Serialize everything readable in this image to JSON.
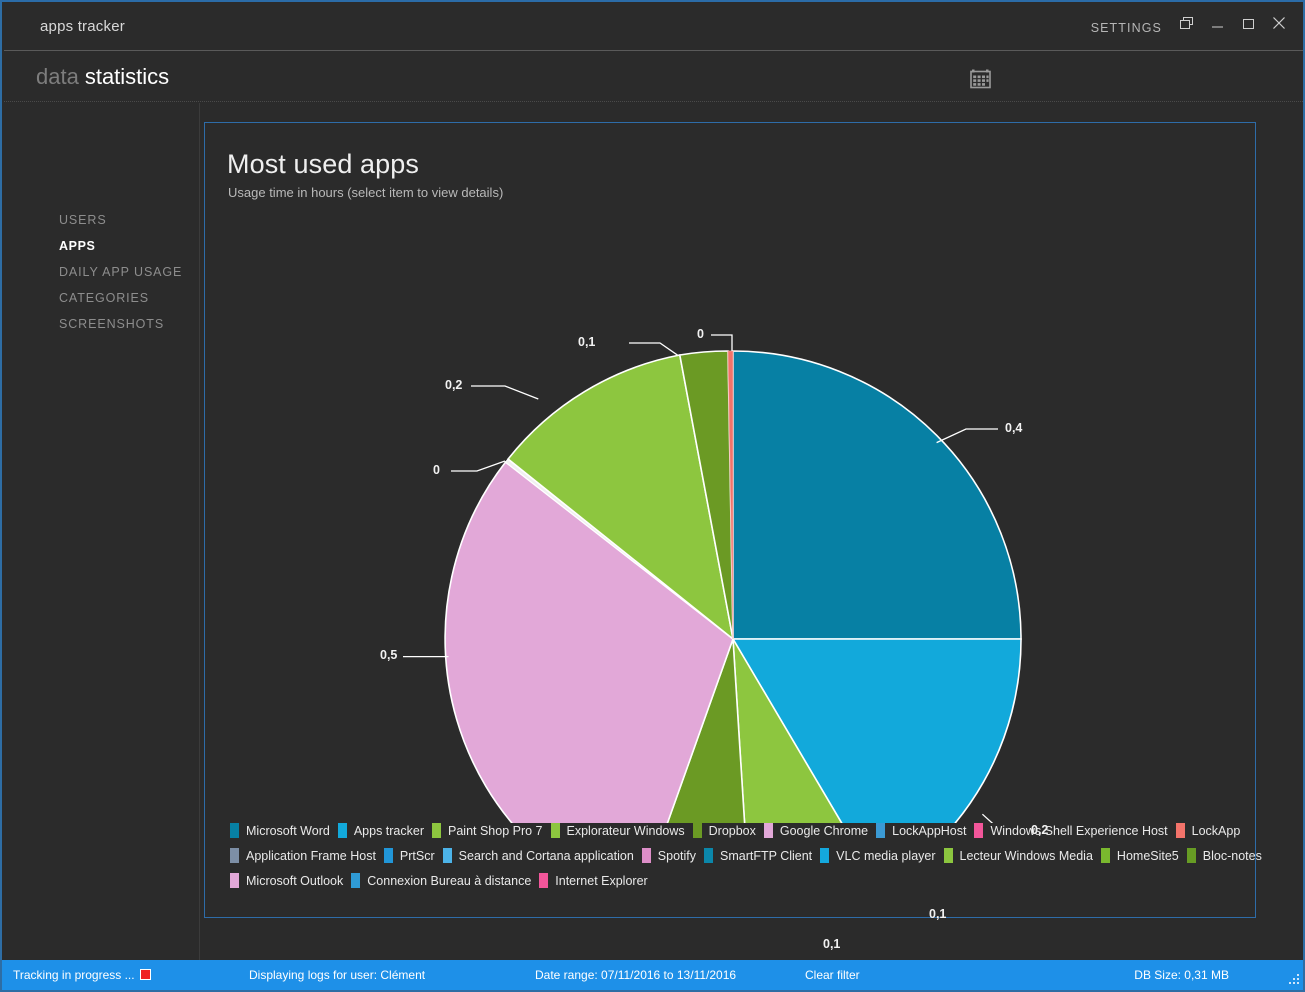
{
  "window": {
    "app_title": "apps tracker",
    "settings_label": "SETTINGS",
    "controls": {
      "restore_down": "restore-down",
      "minimize": "minimize",
      "maximize": "maximize",
      "close": "close"
    }
  },
  "breadcrumb": {
    "parent": "data",
    "current": "statistics"
  },
  "toolbar": {
    "calendar_icon": "calendar-icon"
  },
  "sidebar": {
    "items": [
      {
        "label": "USERS",
        "active": false
      },
      {
        "label": "APPS",
        "active": true
      },
      {
        "label": "DAILY APP USAGE",
        "active": false
      },
      {
        "label": "CATEGORIES",
        "active": false
      },
      {
        "label": "SCREENSHOTS",
        "active": false
      }
    ]
  },
  "card": {
    "title": "Most used apps",
    "subtitle": "Usage time in hours (select item to view details)"
  },
  "chart_data": {
    "type": "pie",
    "title": "Most used apps",
    "subtitle": "Usage time in hours (select item to view details)",
    "value_unit": "hours",
    "label_format": "comma-decimal",
    "legend_position": "bottom",
    "categories": [
      "Microsoft Word",
      "Apps tracker",
      "Paint Shop Pro 7",
      "Explorateur Windows",
      "Dropbox",
      "Google Chrome",
      "LockAppHost",
      "Windows Shell Experience Host",
      "LockApp",
      "Application Frame Host",
      "PrtScr",
      "Search and Cortana application",
      "Spotify",
      "SmartFTP Client",
      "VLC media player",
      "Lecteur Windows Media",
      "HomeSite5",
      "Bloc-notes",
      "Microsoft Outlook",
      "Connexion Bureau à distance",
      "Internet Explorer"
    ],
    "colors": [
      "#0780a4",
      "#12a9db",
      "#8dc63f",
      "#6b9a24",
      "#5f8a1e",
      "#e2a8d8",
      "#3b9ad4",
      "#f2569a",
      "#f3736a",
      "#7d8fa6",
      "#2196d8",
      "#4cb3e8",
      "#dd8ec8",
      "#0b87aa",
      "#14a8dd",
      "#8cc63f",
      "#7ab82e",
      "#679c24",
      "#e2a8d8",
      "#2f9bd6",
      "#f2569a"
    ],
    "values": [
      0.4,
      0.2,
      0.1,
      0.1,
      0.5,
      0.0,
      0.2,
      0.1,
      0.0,
      0.0,
      0.0,
      0.0,
      0.0,
      0.0,
      0.0,
      0.0,
      0.0,
      0.0,
      0.0,
      0.0,
      0.0
    ],
    "slices": [
      {
        "label": "0,4",
        "value": 0.4,
        "color": "#0780a4",
        "fraction": 0.25,
        "leader_angle": 45
      },
      {
        "label": "0,2",
        "value": 0.2,
        "color": "#12a9db",
        "fraction": 0.165,
        "leader_angle": 120
      },
      {
        "label": "0,1",
        "value": 0.1,
        "color": "#8dc63f",
        "fraction": 0.075,
        "leader_angle": 152
      },
      {
        "label": "0,1",
        "value": 0.1,
        "color": "#6b9a24",
        "fraction": 0.065,
        "leader_angle": 178
      },
      {
        "label": "0,5",
        "value": 0.5,
        "color": "#e2a8d8",
        "fraction": 0.3,
        "leader_angle": 250
      },
      {
        "label": "0",
        "value": 0.0,
        "color": "#f2f2f2",
        "fraction": 0.002,
        "leader_angle": 297
      },
      {
        "label": "0,2",
        "value": 0.2,
        "color": "#8dc63f",
        "fraction": 0.115,
        "leader_angle": 308
      },
      {
        "label": "0,1",
        "value": 0.1,
        "color": "#6b9a24",
        "fraction": 0.055,
        "leader_angle": 342
      },
      {
        "label": "0",
        "value": 0.0,
        "color": "#f2569a",
        "fraction": 0.002,
        "leader_angle": 359
      }
    ],
    "callout_labels": [
      "0",
      "0,1",
      "0,2",
      "0",
      "0,5",
      "0,1",
      "0,1",
      "0,2",
      "0,4"
    ]
  },
  "legend": {
    "rows": [
      [
        {
          "label": "Microsoft Word",
          "color": "#0780a4"
        },
        {
          "label": "Apps tracker",
          "color": "#12a9db"
        },
        {
          "label": "Paint Shop Pro 7",
          "color": "#8dc63f"
        },
        {
          "label": "Explorateur Windows",
          "color": "#8dc63f"
        },
        {
          "label": "Dropbox",
          "color": "#6b9a24"
        },
        {
          "label": "Google Chrome",
          "color": "#e2a8d8"
        },
        {
          "label": "LockAppHost",
          "color": "#3b9ad4"
        },
        {
          "label": "Windows Shell Experience Host",
          "color": "#f2569a"
        },
        {
          "label": "LockApp",
          "color": "#f3736a"
        }
      ],
      [
        {
          "label": "Application Frame Host",
          "color": "#7d8fa6"
        },
        {
          "label": "PrtScr",
          "color": "#2196d8"
        },
        {
          "label": "Search and Cortana application",
          "color": "#4cb3e8"
        },
        {
          "label": "Spotify",
          "color": "#dd8ec8"
        },
        {
          "label": "SmartFTP Client",
          "color": "#0b87aa"
        },
        {
          "label": "VLC media player",
          "color": "#14a8dd"
        },
        {
          "label": "Lecteur Windows Media",
          "color": "#8cc63f"
        },
        {
          "label": "HomeSite5",
          "color": "#7ab82e"
        },
        {
          "label": "Bloc-notes",
          "color": "#679c24"
        }
      ],
      [
        {
          "label": "Microsoft Outlook",
          "color": "#e2a8d8"
        },
        {
          "label": "Connexion Bureau à distance",
          "color": "#2f9bd6"
        },
        {
          "label": "Internet Explorer",
          "color": "#f2569a"
        }
      ]
    ]
  },
  "statusbar": {
    "tracking": "Tracking in progress ...",
    "user": "Displaying logs for user: Clément",
    "date_range": "Date range: 07/11/2016 to 13/11/2016",
    "clear_filter": "Clear filter",
    "db_size": "DB Size: 0,31 MB"
  },
  "theme": {
    "accent": "#1e90e8",
    "panel_border": "#2e6ca8",
    "background": "#2b2b2b",
    "text": "#e9e9e9"
  }
}
